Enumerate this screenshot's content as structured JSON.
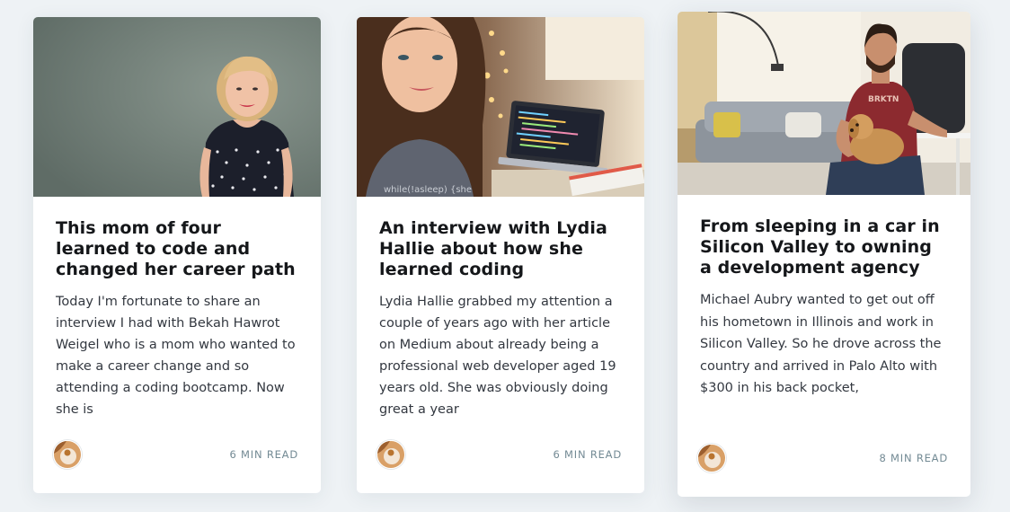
{
  "posts": [
    {
      "title": "This mom of four learned to code and changed her career path",
      "excerpt": "Today I'm fortunate to share an interview I had with Bekah Hawrot Weigel who is a mom who wanted to make a career change and so attending a coding bootcamp. Now she is",
      "reading_time": "6 MIN READ",
      "image": "portrait-of-woman-with-blonde-hair-polka-dot-dress"
    },
    {
      "title": "An interview with Lydia Hallie about how she learned coding",
      "excerpt": "Lydia Hallie grabbed my attention a couple of years ago with her article on Medium about already being a professional web developer aged 19 years old. She was obviously doing great a year",
      "reading_time": "6 MIN READ",
      "image": "selfie-of-woman-with-laptop-showing-code",
      "image_caption": "while(!asleep) {she"
    },
    {
      "title": "From sleeping in a car in Silicon Valley to owning a development agency",
      "excerpt": "Michael Aubry wanted to get out off his hometown in Illinois and work in Silicon Valley. So he drove across the country and arrived in Palo Alto with $300 in his back pocket,",
      "reading_time": "8 MIN READ",
      "image": "man-with-dog-at-desk-in-living-room",
      "image_caption": "BRKTN"
    }
  ],
  "colors": {
    "background": "#eef2f5",
    "card": "#ffffff",
    "title": "#15171a",
    "excerpt": "#333840",
    "reading_time": "#738a94"
  }
}
